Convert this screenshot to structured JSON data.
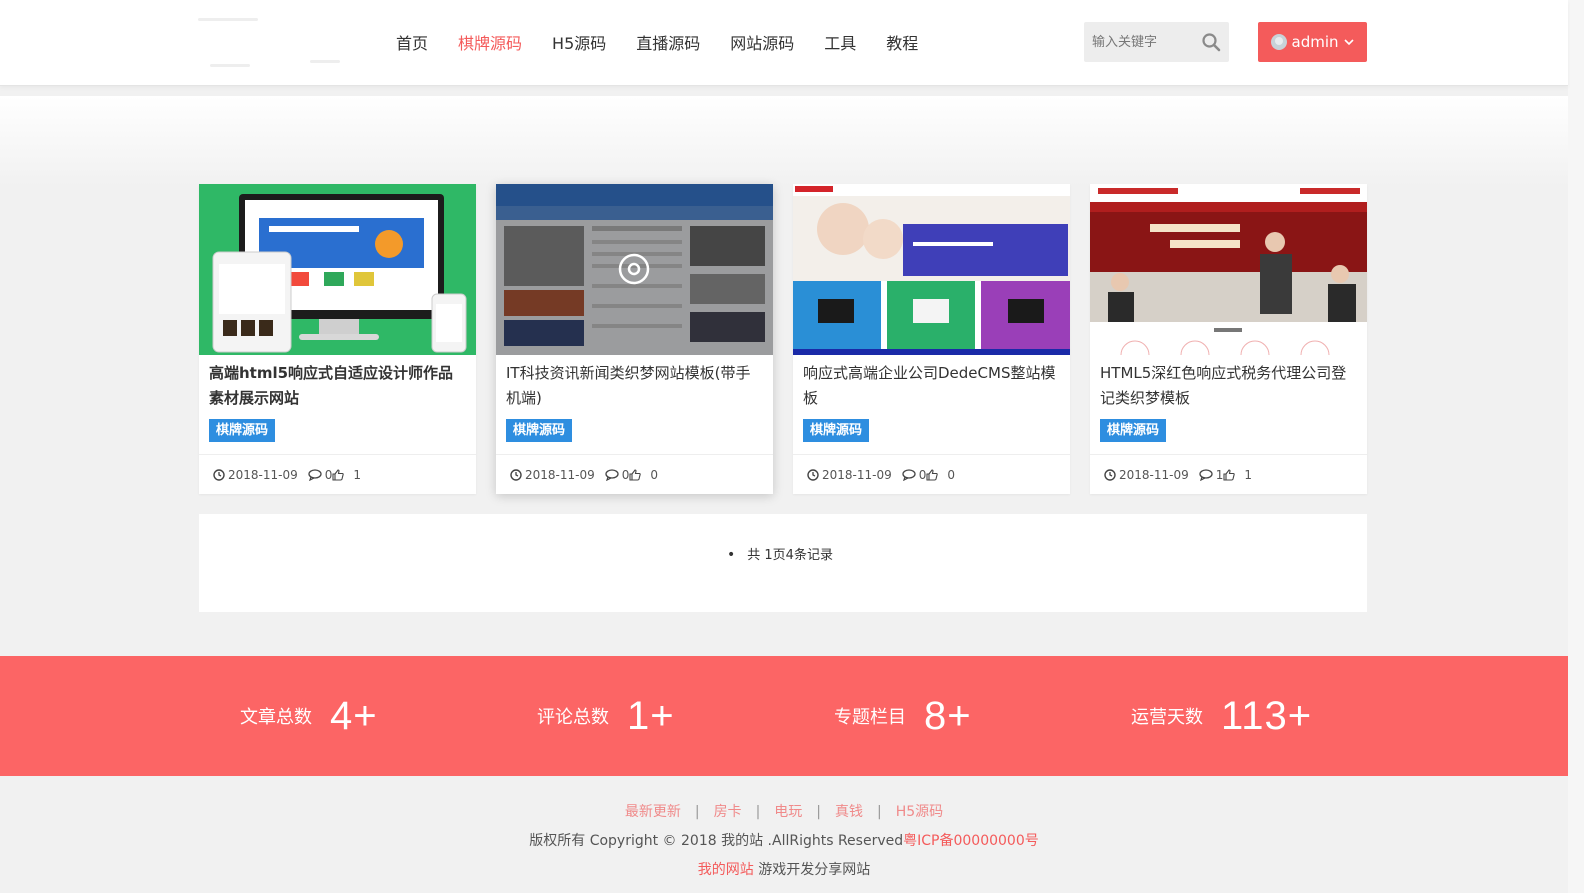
{
  "header": {
    "nav": [
      {
        "label": "首页",
        "active": false
      },
      {
        "label": "棋牌源码",
        "active": true
      },
      {
        "label": "H5源码",
        "active": false
      },
      {
        "label": "直播源码",
        "active": false
      },
      {
        "label": "网站源码",
        "active": false
      },
      {
        "label": "工具",
        "active": false
      },
      {
        "label": "教程",
        "active": false
      }
    ],
    "search_placeholder": "输入关键字",
    "search_icon": "search-icon",
    "user_label": "admin",
    "accent_color": "#f45b5b"
  },
  "cards": [
    {
      "title": "高端html5响应式自适应设计师作品素材展示网站",
      "tag": "棋牌源码",
      "date": "2018-11-09",
      "comments": "0",
      "likes": "1"
    },
    {
      "title": "IT科技资讯新闻类织梦网站模板(带手机端)",
      "tag": "棋牌源码",
      "date": "2018-11-09",
      "comments": "0",
      "likes": "0"
    },
    {
      "title": "响应式高端企业公司DedeCMS整站模板",
      "tag": "棋牌源码",
      "date": "2018-11-09",
      "comments": "0",
      "likes": "0"
    },
    {
      "title": "HTML5深红色响应式税务代理公司登记类织梦模板",
      "tag": "棋牌源码",
      "date": "2018-11-09",
      "comments": "1",
      "likes": "1"
    }
  ],
  "pager": {
    "text": "共 1页4条记录"
  },
  "stats": [
    {
      "label": "文章总数",
      "value": "4+"
    },
    {
      "label": "评论总数",
      "value": "1+"
    },
    {
      "label": "专题栏目",
      "value": "8+"
    },
    {
      "label": "运营天数",
      "value": "113+"
    }
  ],
  "stats_color": "#fc6565",
  "footer": {
    "links": [
      "最新更新",
      "房卡",
      "电玩",
      "真钱",
      "H5源码"
    ],
    "copyright": "版权所有 Copyright © 2018 我的站 .AllRights Reserved",
    "icp": "粤ICP备00000000号",
    "site_name": "我的网站",
    "site_desc": "游戏开发分享网站"
  }
}
